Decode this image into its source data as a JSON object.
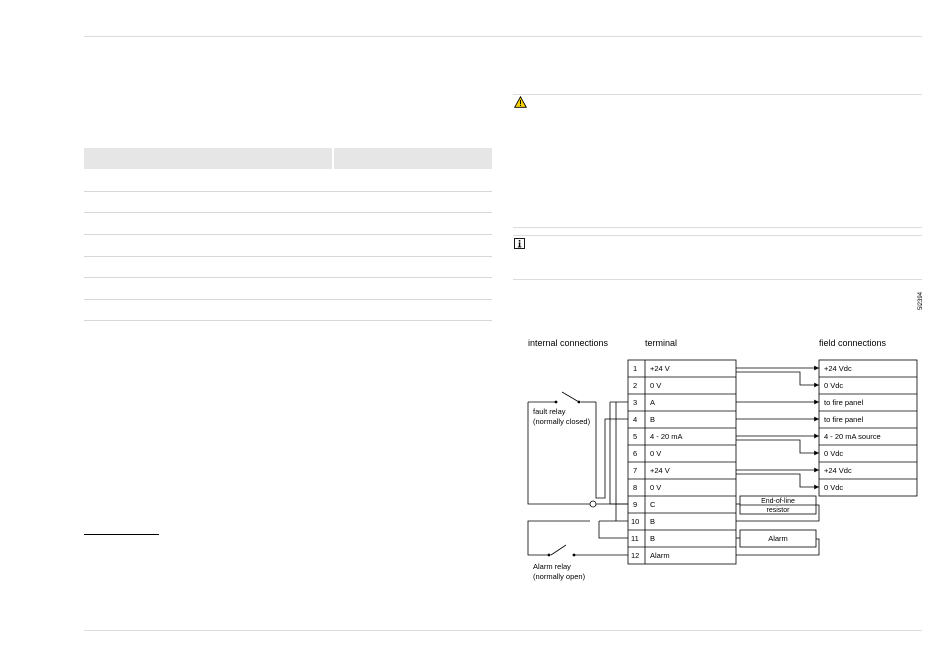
{
  "diagram": {
    "figure_id": "5l2394",
    "headings": {
      "internal": "internal connections",
      "terminal": "terminal",
      "field": "field connections"
    },
    "relays": {
      "fault": [
        "fault relay",
        "(normally closed)"
      ],
      "alarm": [
        "Alarm relay",
        "(normally open)"
      ]
    },
    "terminals": [
      {
        "num": "1",
        "label": "+24 V"
      },
      {
        "num": "2",
        "label": "0 V"
      },
      {
        "num": "3",
        "label": "A"
      },
      {
        "num": "4",
        "label": "B"
      },
      {
        "num": "5",
        "label": "4 - 20 mA"
      },
      {
        "num": "6",
        "label": "0 V"
      },
      {
        "num": "7",
        "label": "+24 V"
      },
      {
        "num": "8",
        "label": "0 V"
      },
      {
        "num": "9",
        "label": "C"
      },
      {
        "num": "10",
        "label": "B"
      },
      {
        "num": "11",
        "label": "B"
      },
      {
        "num": "12",
        "label": "Alarm"
      }
    ],
    "field": [
      "+24 Vdc",
      "0 Vdc",
      "to fire panel",
      "to fire panel",
      "4 - 20 mA source",
      "0 Vdc",
      "+24 Vdc",
      "0 Vdc"
    ],
    "end_of_line": [
      "End-of-line",
      "resistor"
    ],
    "alarm_box": "Alarm"
  },
  "icons": {
    "warning": "warning-triangle-icon",
    "info": "info-icon"
  },
  "colors": {
    "rule": "#dcdcdc",
    "table_header": "#e6e6e6",
    "warning_fill": "#f5d300"
  }
}
